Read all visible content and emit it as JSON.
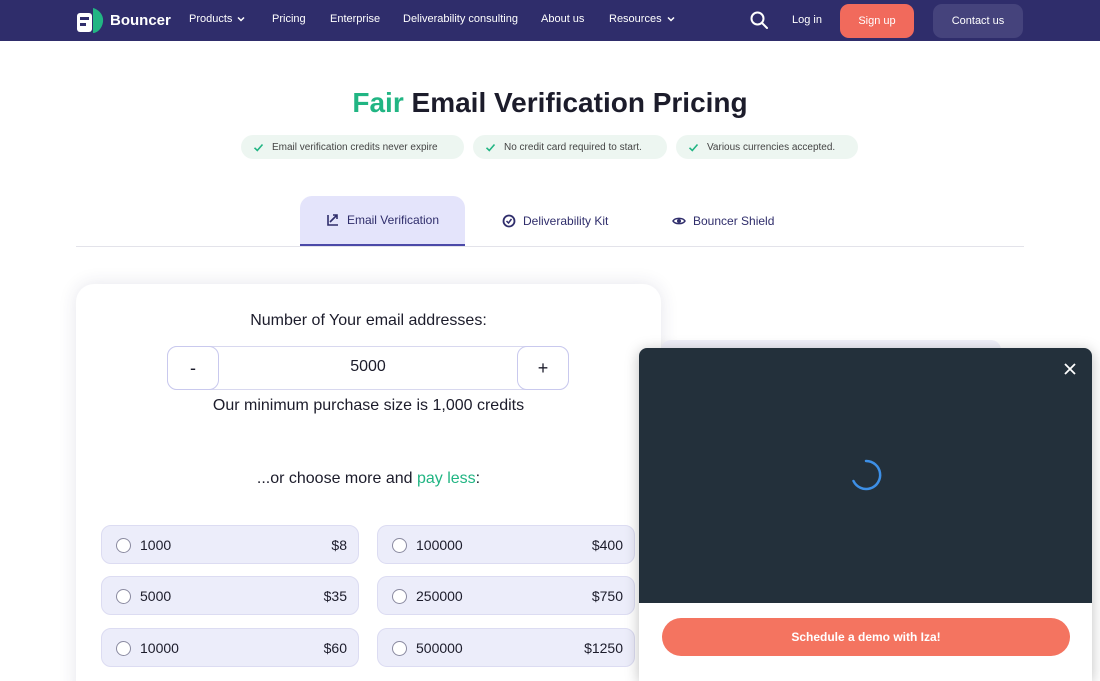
{
  "nav": {
    "brand": "Bouncer",
    "links": [
      "Products",
      "Pricing",
      "Enterprise",
      "Deliverability consulting",
      "About us",
      "Resources"
    ],
    "login": "Log in",
    "signup": "Sign up",
    "contact": "Contact us"
  },
  "hero": {
    "title_accent": "Fair",
    "title_rest": " Email Verification Pricing",
    "pills": [
      "Email verification credits never expire",
      "No credit card required to start.",
      "Various currencies accepted."
    ]
  },
  "tabs": [
    "Email Verification",
    "Deliverability Kit",
    "Bouncer Shield"
  ],
  "calculator": {
    "label": "Number of Your email addresses:",
    "minus": "-",
    "plus": "+",
    "value": "5000",
    "min_note": "Our minimum purchase size is 1,000 credits",
    "choose_prefix": "...or choose more and ",
    "choose_accent": "pay less",
    "choose_suffix": ":",
    "options": [
      {
        "amount": "1000",
        "price": "$8"
      },
      {
        "amount": "100000",
        "price": "$400"
      },
      {
        "amount": "5000",
        "price": "$35"
      },
      {
        "amount": "250000",
        "price": "$750"
      },
      {
        "amount": "10000",
        "price": "$60"
      },
      {
        "amount": "500000",
        "price": "$1250"
      }
    ]
  },
  "widget": {
    "button": "Schedule a demo with Iza!"
  },
  "colors": {
    "nav_bg": "#2f2d6b",
    "accent_green": "#21b583",
    "signup_bg": "#f16a5c",
    "demo_button": "#f47460",
    "widget_dark": "#23303b"
  }
}
